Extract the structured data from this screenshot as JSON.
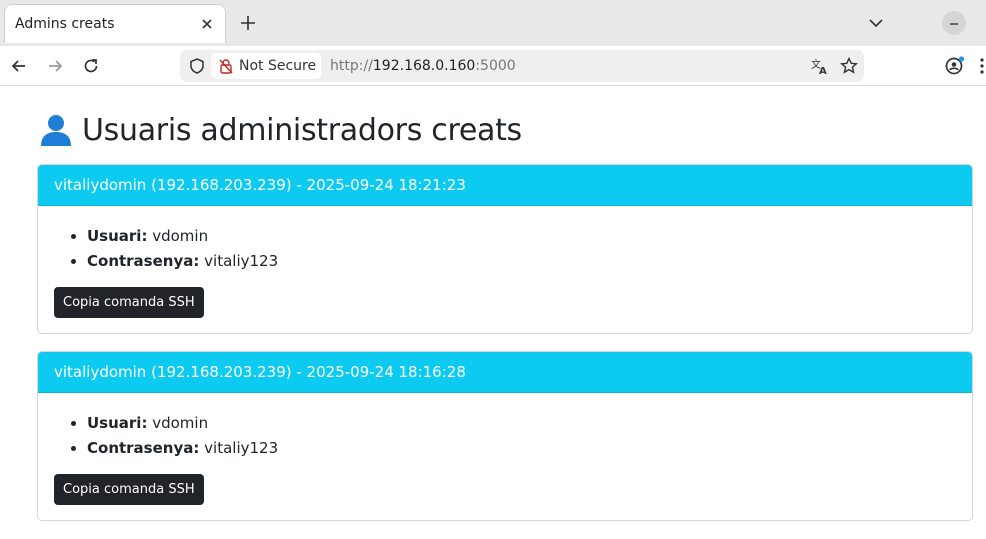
{
  "browser": {
    "tab_title": "Admins creats",
    "security_label": "Not Secure",
    "url_prefix": "http://",
    "url_host": "192.168.0.160",
    "url_port": ":5000"
  },
  "page": {
    "title": "Usuaris administradors creats"
  },
  "labels": {
    "user": "Usuari:",
    "password": "Contrasenya:",
    "ssh_button": "Copia comanda SSH"
  },
  "entries": [
    {
      "header": "vitaliydomin (192.168.203.239) - 2025-09-24 18:21:23",
      "user": "vdomin",
      "password": "vitaliy123"
    },
    {
      "header": "vitaliydomin (192.168.203.239) - 2025-09-24 18:16:28",
      "user": "vdomin",
      "password": "vitaliy123"
    }
  ],
  "colors": {
    "card_header": "#0dcaf0",
    "button_dark": "#212529",
    "title_icon": "#1f7fd6"
  },
  "icons": [
    "close-icon",
    "plus-icon",
    "chevron-down-icon",
    "back-icon",
    "forward-icon",
    "reload-icon",
    "shield-icon",
    "insecure-lock-icon",
    "translate-icon",
    "star-icon",
    "profile-icon",
    "user-icon"
  ]
}
